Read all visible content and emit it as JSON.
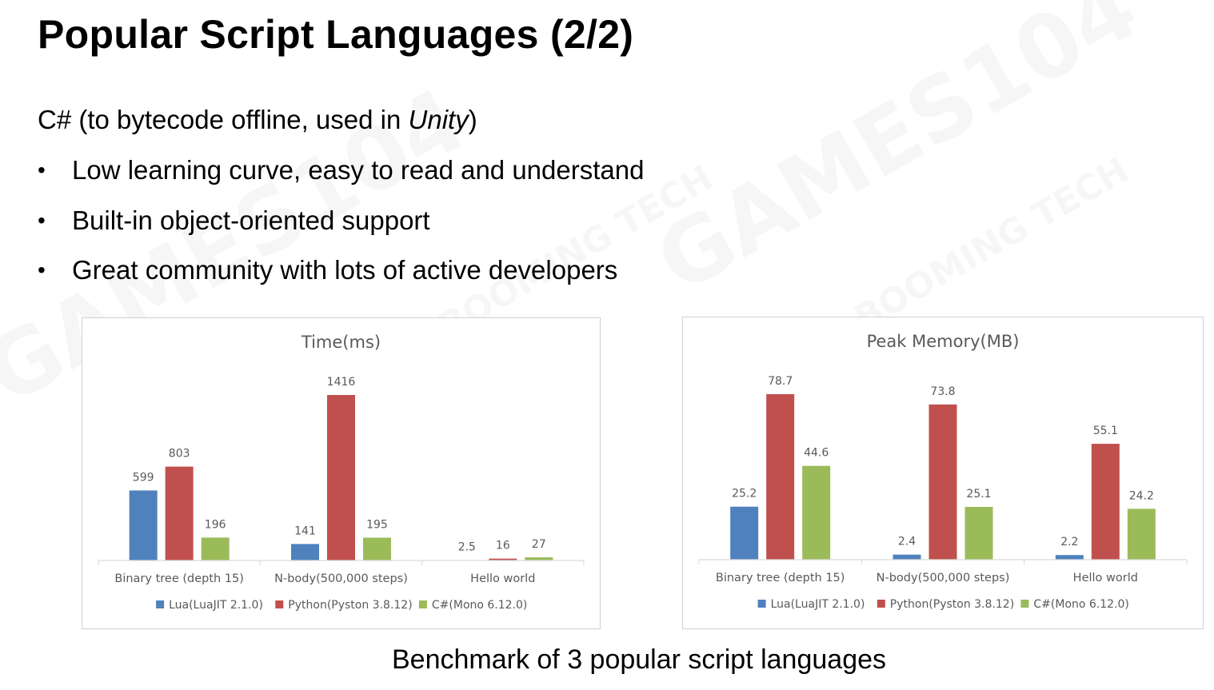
{
  "slide": {
    "title": "Popular Script Languages (2/2)",
    "subtitle_lang": "C#",
    "subtitle_mid": " (to bytecode offline, used in ",
    "subtitle_italic": "Unity",
    "subtitle_end": ")",
    "bullets": [
      "Low learning curve, easy to read and understand",
      "Built-in object-oriented support",
      "Great community with lots of active developers"
    ],
    "caption": "Benchmark of 3 popular script languages",
    "watermark_text": "GAMES104",
    "watermark_sub": "BOOMING TECH"
  },
  "colors": {
    "lua": "#4F81BD",
    "python": "#C0504D",
    "csharp": "#9BBB59",
    "axis": "#D9D9D9",
    "text": "#595959"
  },
  "chart_data": [
    {
      "type": "bar",
      "title": "Time(ms)",
      "categories": [
        "Binary tree (depth 15)",
        "N-body(500,000 steps)",
        "Hello world"
      ],
      "series": [
        {
          "name": "Lua(LuaJIT 2.1.0)",
          "values": [
            599,
            141,
            2.5
          ],
          "labels": [
            "599",
            "141",
            "2.5"
          ]
        },
        {
          "name": "Python(Pyston 3.8.12)",
          "values": [
            803,
            1416,
            16
          ],
          "labels": [
            "803",
            "1416",
            "16"
          ]
        },
        {
          "name": "C#(Mono 6.12.0)",
          "values": [
            196,
            195,
            27
          ],
          "labels": [
            "196",
            "195",
            "27"
          ]
        }
      ],
      "ylim": [
        0,
        1416
      ],
      "grid": false,
      "legend": "bottom"
    },
    {
      "type": "bar",
      "title": "Peak Memory(MB)",
      "categories": [
        "Binary tree (depth 15)",
        "N-body(500,000 steps)",
        "Hello world"
      ],
      "series": [
        {
          "name": "Lua(LuaJIT 2.1.0)",
          "values": [
            25.2,
            2.4,
            2.2
          ],
          "labels": [
            "25.2",
            "2.4",
            "2.2"
          ]
        },
        {
          "name": "Python(Pyston 3.8.12)",
          "values": [
            78.7,
            73.8,
            55.1
          ],
          "labels": [
            "78.7",
            "73.8",
            "55.1"
          ]
        },
        {
          "name": "C#(Mono 6.12.0)",
          "values": [
            44.6,
            25.1,
            24.2
          ],
          "labels": [
            "44.6",
            "25.1",
            "24.2"
          ]
        }
      ],
      "ylim": [
        0,
        78.7
      ],
      "grid": false,
      "legend": "bottom"
    }
  ]
}
